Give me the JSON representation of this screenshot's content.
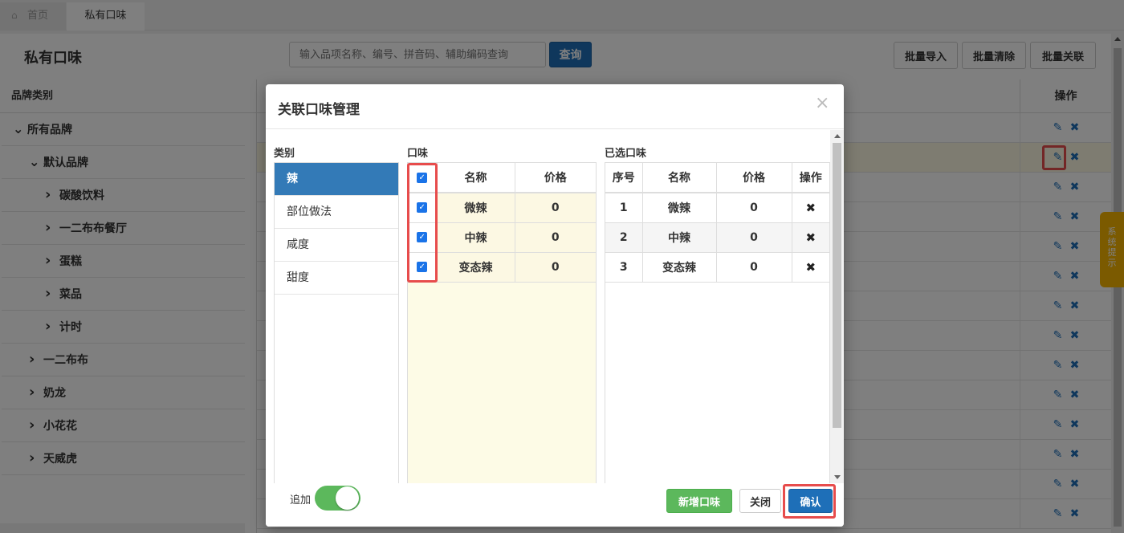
{
  "tabs": {
    "home": "首页",
    "active": "私有口味"
  },
  "page": {
    "title": "私有口味",
    "search_placeholder": "输入品项名称、编号、拼音码、辅助编码查询",
    "search_btn": "查询",
    "batch_import": "批量导入",
    "batch_clear": "批量清除",
    "batch_link": "批量关联",
    "grid_op_header": "操作"
  },
  "tree": {
    "header": "品牌类别",
    "items": [
      {
        "label": "所有品牌",
        "level": 0,
        "expanded": true
      },
      {
        "label": "默认品牌",
        "level": 1,
        "expanded": true
      },
      {
        "label": "碳酸饮料",
        "level": 2,
        "expanded": false
      },
      {
        "label": "一二布布餐厅",
        "level": 2,
        "expanded": false
      },
      {
        "label": "蛋糕",
        "level": 2,
        "expanded": false
      },
      {
        "label": "菜品",
        "level": 2,
        "expanded": false
      },
      {
        "label": "计时",
        "level": 2,
        "expanded": false
      },
      {
        "label": "一二布布",
        "level": 1,
        "expanded": false
      },
      {
        "label": "奶龙",
        "level": 1,
        "expanded": false
      },
      {
        "label": "小花花",
        "level": 1,
        "expanded": false
      },
      {
        "label": "天威虎",
        "level": 1,
        "expanded": false
      }
    ]
  },
  "side_tip": "系统提示",
  "modal": {
    "title": "关联口味管理",
    "close_glyph": "×",
    "category_label": "类别",
    "categories": [
      "辣",
      "部位做法",
      "咸度",
      "甜度"
    ],
    "flavor_label": "口味",
    "flavor_headers": [
      "名称",
      "价格"
    ],
    "flavors": [
      {
        "name": "微辣",
        "price": "0",
        "checked": true
      },
      {
        "name": "中辣",
        "price": "0",
        "checked": true
      },
      {
        "name": "变态辣",
        "price": "0",
        "checked": true
      }
    ],
    "selected_label": "已选口味",
    "selected_headers": [
      "序号",
      "名称",
      "价格",
      "操作"
    ],
    "selected": [
      {
        "no": "1",
        "name": "微辣",
        "price": "0"
      },
      {
        "no": "2",
        "name": "中辣",
        "price": "0"
      },
      {
        "no": "3",
        "name": "变态辣",
        "price": "0"
      }
    ],
    "toggle_label": "追加",
    "toggle_on": true,
    "btn_add": "新增口味",
    "btn_close": "关闭",
    "btn_ok": "确认"
  },
  "colors": {
    "primary": "#1e6fb8",
    "success": "#5cb85c",
    "highlight": "#e74c4c",
    "warning": "#f7b500"
  },
  "icons": {
    "home": "home-icon",
    "edit": "edit-icon",
    "delete": "close-icon",
    "caret": "chevron-icon"
  }
}
